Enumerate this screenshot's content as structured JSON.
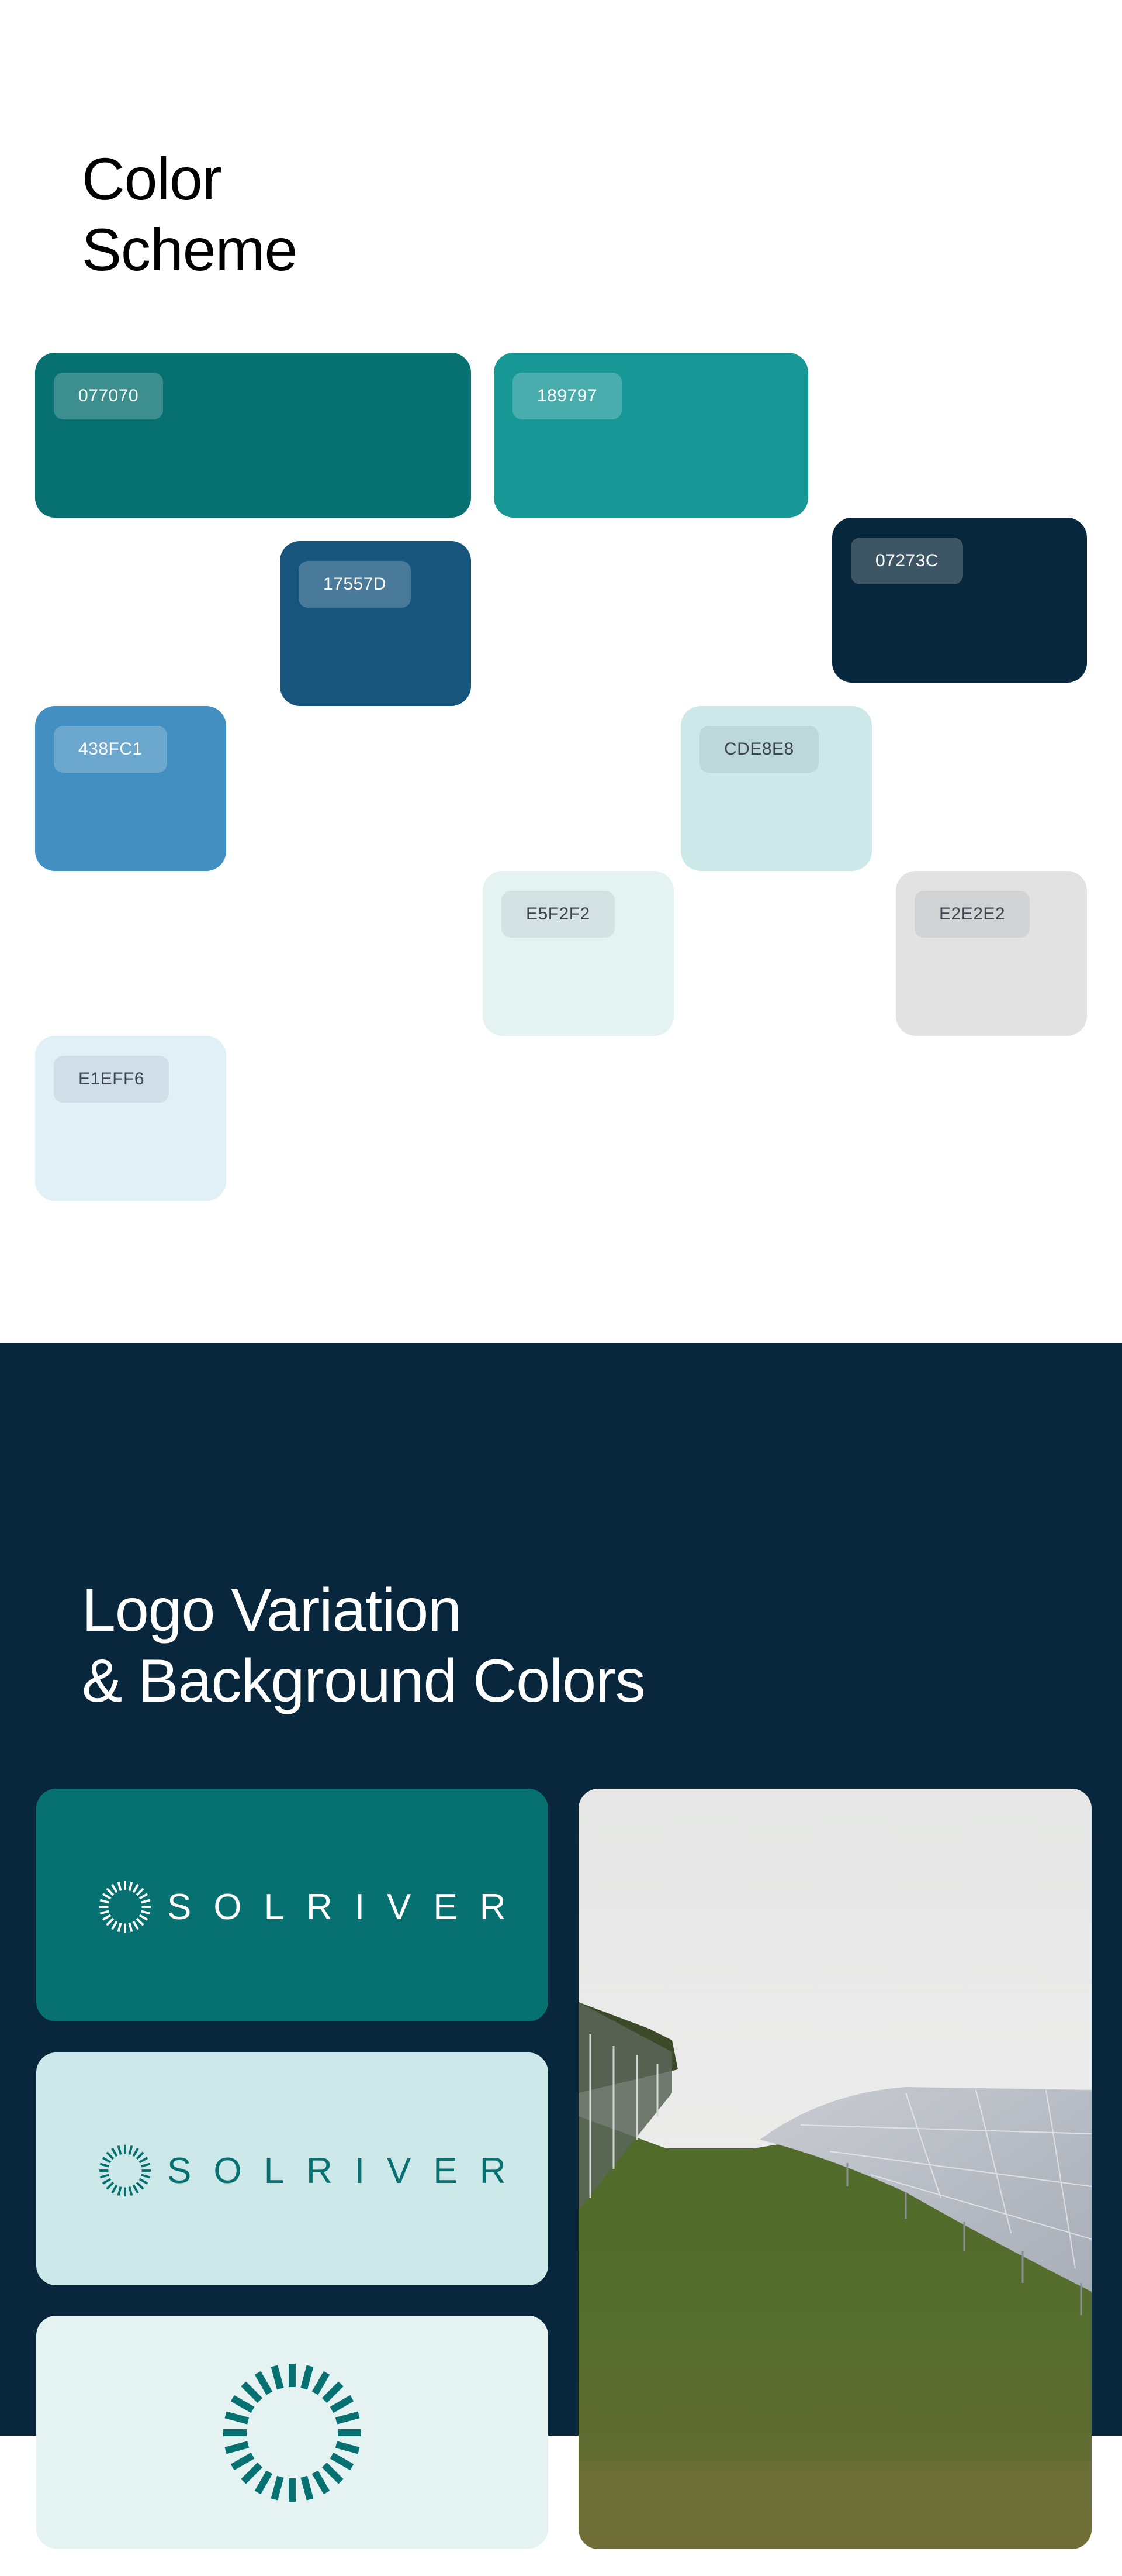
{
  "color_scheme": {
    "heading_line1": "Color",
    "heading_line2": "Scheme",
    "swatches": [
      {
        "code": "077070",
        "color": "#077070"
      },
      {
        "code": "189797",
        "color": "#189797"
      },
      {
        "code": "17557D",
        "color": "#17557D"
      },
      {
        "code": "07273C",
        "color": "#07273C"
      },
      {
        "code": "438FC1",
        "color": "#438FC1"
      },
      {
        "code": "CDE8E8",
        "color": "#CDE8E8"
      },
      {
        "code": "E5F2F2",
        "color": "#E5F2F2"
      },
      {
        "code": "E2E2E2",
        "color": "#E2E2E2"
      },
      {
        "code": "E1EFF6",
        "color": "#E1EFF6"
      }
    ]
  },
  "logo_variation": {
    "heading_line1": "Logo Variation",
    "heading_line2": "& Background Colors",
    "section_background": "#09273C",
    "brand_name": "SOLRIVER",
    "cards": [
      {
        "background": "#077070",
        "logo_color": "#FFFFFF",
        "variant": "full-logo"
      },
      {
        "background": "#CDE8E8",
        "logo_color": "#077070",
        "variant": "full-logo"
      },
      {
        "background": "#E5F2F2",
        "logo_color": "#077070",
        "variant": "icon-only"
      }
    ],
    "photo_icon": "solar-farm-photo"
  }
}
